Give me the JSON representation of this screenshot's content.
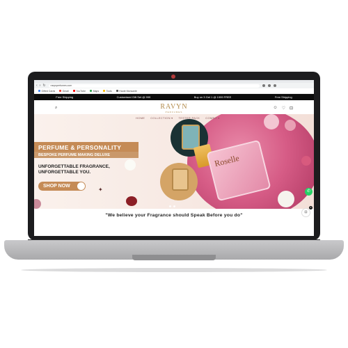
{
  "browser": {
    "url": "ravynperfumes.com",
    "bookmarks": [
      "Gifted Cards",
      "Gmail",
      "YouTube",
      "Maps",
      "Tools",
      "Haute Monsante"
    ]
  },
  "announcement": {
    "items": [
      "Free Shipping",
      "Customised Gift Set @ 999",
      "Buy on 3 Get 1 @ 1999 FREE",
      "Free Shipping"
    ]
  },
  "header": {
    "logo_main": "RAVYN",
    "logo_sub": "PERFUMES",
    "menu": [
      "HOME",
      "COLLECTION ▾",
      "TESTER PACK",
      "COMBO ▾"
    ]
  },
  "hero": {
    "banner_title": "PERFUME & PERSONALITY",
    "banner_subtitle": "BESPOKE PERFUME MAKING DELUXE",
    "tagline": "UNFORGETTABLE FRAGRANCE, UNFORGETTABLE YOU.",
    "cta_label": "SHOP NOW",
    "product_label": "Roselle"
  },
  "quote": "\"We believe your Fragrance should Speak Before you do\"",
  "colors": {
    "accent": "#c58b56",
    "announce_bg": "#0c0c0c",
    "silk": "#d65c86"
  }
}
